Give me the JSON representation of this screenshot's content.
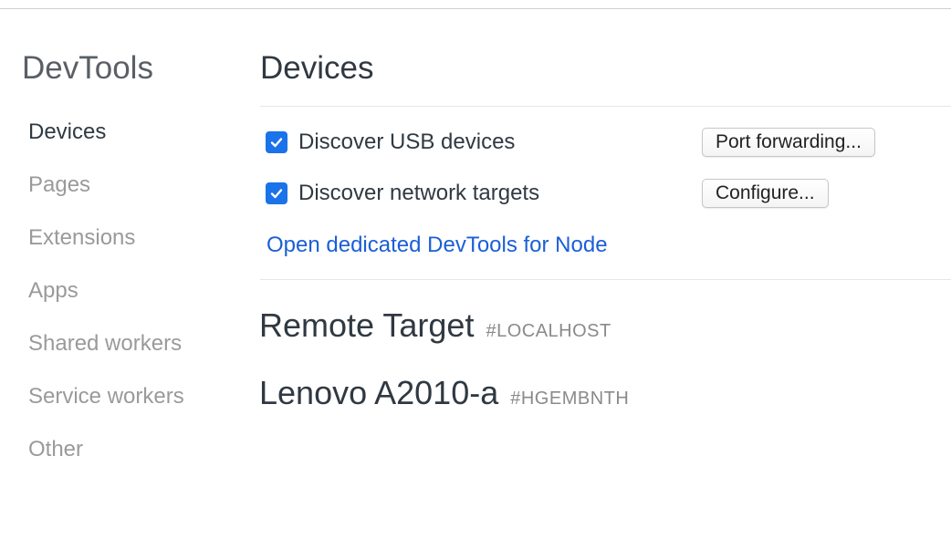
{
  "sidebar": {
    "title": "DevTools",
    "items": [
      {
        "label": "Devices",
        "active": true
      },
      {
        "label": "Pages",
        "active": false
      },
      {
        "label": "Extensions",
        "active": false
      },
      {
        "label": "Apps",
        "active": false
      },
      {
        "label": "Shared workers",
        "active": false
      },
      {
        "label": "Service workers",
        "active": false
      },
      {
        "label": "Other",
        "active": false
      }
    ]
  },
  "main": {
    "title": "Devices",
    "options": [
      {
        "label": "Discover USB devices",
        "checked": true,
        "button_label": "Port forwarding..."
      },
      {
        "label": "Discover network targets",
        "checked": true,
        "button_label": "Configure..."
      }
    ],
    "node_link": "Open dedicated DevTools for Node",
    "targets": [
      {
        "name": "Remote Target",
        "id": "#LOCALHOST"
      },
      {
        "name": "Lenovo A2010-a",
        "id": "#HGEMBNTH"
      }
    ]
  },
  "colors": {
    "accent": "#1a73e8",
    "link": "#1a5fd6",
    "text": "#303942",
    "muted": "#9a9a9a"
  },
  "icons": {
    "checkbox": "checkmark-icon"
  }
}
